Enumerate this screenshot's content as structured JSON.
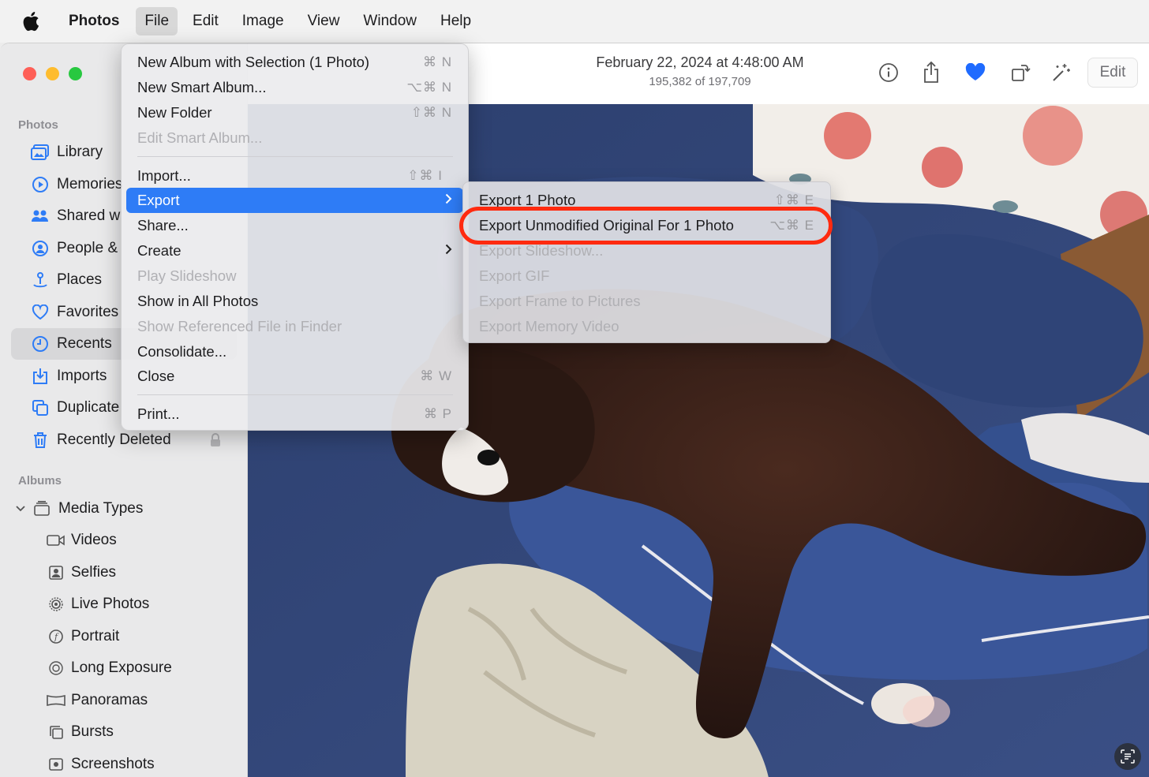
{
  "menubar": {
    "app": "Photos",
    "items": [
      "File",
      "Edit",
      "Image",
      "View",
      "Window",
      "Help"
    ]
  },
  "sidebar": {
    "photos_header": "Photos",
    "items": [
      {
        "label": "Library",
        "icon": "library-icon"
      },
      {
        "label": "Memories",
        "icon": "memories-icon"
      },
      {
        "label": "Shared w",
        "icon": "shared-icon"
      },
      {
        "label": "People &",
        "icon": "people-icon"
      },
      {
        "label": "Places",
        "icon": "places-icon"
      },
      {
        "label": "Favorites",
        "icon": "heart-icon"
      },
      {
        "label": "Recents",
        "icon": "clock-icon",
        "selected": true
      },
      {
        "label": "Imports",
        "icon": "import-icon"
      },
      {
        "label": "Duplicate",
        "icon": "duplicate-icon"
      },
      {
        "label": "Recently Deleted",
        "icon": "trash-icon"
      }
    ],
    "albums_header": "Albums",
    "media_types": "Media Types",
    "sub_items": [
      {
        "label": "Videos",
        "icon": "video-icon"
      },
      {
        "label": "Selfies",
        "icon": "selfie-icon"
      },
      {
        "label": "Live Photos",
        "icon": "live-photo-icon"
      },
      {
        "label": "Portrait",
        "icon": "portrait-icon"
      },
      {
        "label": "Long Exposure",
        "icon": "long-exposure-icon"
      },
      {
        "label": "Panoramas",
        "icon": "panorama-icon"
      },
      {
        "label": "Bursts",
        "icon": "bursts-icon"
      },
      {
        "label": "Screenshots",
        "icon": "screenshot-icon"
      }
    ]
  },
  "toolbar": {
    "date": "February 22, 2024 at 4:48:00 AM",
    "count": "195,382 of 197,709",
    "edit_label": "Edit"
  },
  "file_menu": {
    "items": [
      {
        "label": "New Album with Selection (1 Photo)",
        "shortcut": "⌘ N"
      },
      {
        "label": "New Smart Album...",
        "shortcut": "⌥⌘ N"
      },
      {
        "label": "New Folder",
        "shortcut": "⇧⌘ N"
      },
      {
        "label": "Edit Smart Album...",
        "shortcut": "",
        "disabled": true
      },
      {
        "label": "Import...",
        "shortcut": "⇧⌘ I"
      },
      {
        "label": "Export",
        "shortcut": "",
        "highlighted": true
      },
      {
        "label": "Share...",
        "shortcut": ""
      },
      {
        "label": "Create",
        "shortcut": ""
      },
      {
        "label": "Play Slideshow",
        "shortcut": "",
        "disabled": true
      },
      {
        "label": "Show in All Photos",
        "shortcut": ""
      },
      {
        "label": "Show Referenced File in Finder",
        "shortcut": "",
        "disabled": true
      },
      {
        "label": "Consolidate...",
        "shortcut": ""
      },
      {
        "label": "Close",
        "shortcut": "⌘ W"
      },
      {
        "label": "Print...",
        "shortcut": "⌘ P"
      }
    ]
  },
  "export_menu": {
    "items": [
      {
        "label": "Export 1 Photo",
        "shortcut": "⇧⌘ E"
      },
      {
        "label": "Export Unmodified Original For 1 Photo",
        "shortcut": "⌥⌘ E"
      },
      {
        "label": "Export Slideshow...",
        "shortcut": "",
        "disabled": true
      },
      {
        "label": "Export GIF",
        "shortcut": "",
        "disabled": true
      },
      {
        "label": "Export Frame to Pictures",
        "shortcut": "",
        "disabled": true
      },
      {
        "label": "Export Memory Video",
        "shortcut": "",
        "disabled": true
      }
    ]
  },
  "colors": {
    "accent": "#2e7cf6",
    "annotation_red": "#ff2a0f",
    "favorite_blue": "#1f6bff"
  }
}
